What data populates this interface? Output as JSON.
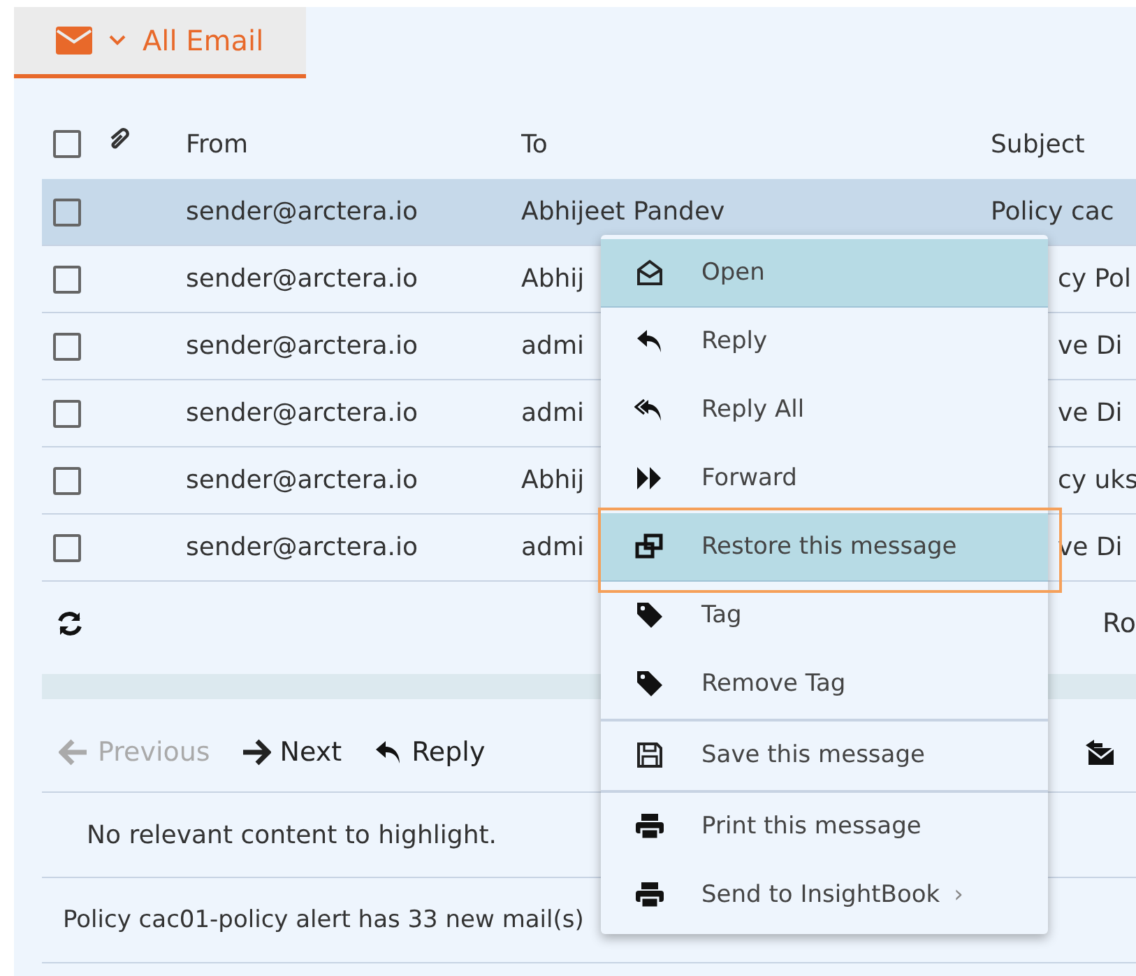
{
  "folder_tab": {
    "label": "All Email",
    "selected": true
  },
  "table": {
    "header_checkbox": {
      "checked": false
    },
    "columns": [
      "From",
      "To",
      "Subject"
    ],
    "rows": [
      {
        "checked": false,
        "selected": true,
        "from": "sender@arctera.io",
        "to": "Abhijeet Pandev",
        "subject": "Policy cac"
      },
      {
        "checked": false,
        "selected": false,
        "from": "sender@arctera.io",
        "to": "Abhij",
        "subject": "cy Pol"
      },
      {
        "checked": false,
        "selected": false,
        "from": "sender@arctera.io",
        "to": "admi",
        "subject": "ve Di"
      },
      {
        "checked": false,
        "selected": false,
        "from": "sender@arctera.io",
        "to": "admi",
        "subject": "ve Di"
      },
      {
        "checked": false,
        "selected": false,
        "from": "sender@arctera.io",
        "to": "Abhij",
        "subject": "cy uks"
      },
      {
        "checked": false,
        "selected": false,
        "from": "sender@arctera.io",
        "to": "admi",
        "subject": "ve Di"
      }
    ]
  },
  "list_footer": {
    "right_text": "Ro"
  },
  "toolbar": [
    {
      "kind": "previous",
      "label": "Previous",
      "disabled": true
    },
    {
      "kind": "next",
      "label": "Next",
      "disabled": false
    },
    {
      "kind": "reply",
      "label": "Reply",
      "disabled": false
    }
  ],
  "preview_text": "No relevant content to highlight.",
  "status_text": "Policy cac01-policy alert has 33 new mail(s)",
  "context_menu": {
    "groups": [
      [
        {
          "kind": "open",
          "label": "Open",
          "selected": true,
          "outlined": false
        },
        {
          "kind": "reply",
          "label": "Reply",
          "selected": false,
          "outlined": false
        },
        {
          "kind": "reply-all",
          "label": "Reply All",
          "selected": false,
          "outlined": false
        },
        {
          "kind": "forward",
          "label": "Forward",
          "selected": false,
          "outlined": false
        },
        {
          "kind": "restore",
          "label": "Restore this message",
          "selected": true,
          "outlined": true
        },
        {
          "kind": "tag",
          "label": "Tag",
          "selected": false,
          "outlined": false
        },
        {
          "kind": "tag",
          "label": "Remove Tag",
          "selected": false,
          "outlined": false
        }
      ],
      [
        {
          "kind": "save",
          "label": "Save this message",
          "selected": false,
          "outlined": false
        }
      ],
      [
        {
          "kind": "print",
          "label": "Print this message",
          "selected": false,
          "outlined": false
        },
        {
          "kind": "print",
          "label": "Send to InsightBook",
          "arrow": "›",
          "selected": false,
          "outlined": false
        }
      ]
    ]
  }
}
